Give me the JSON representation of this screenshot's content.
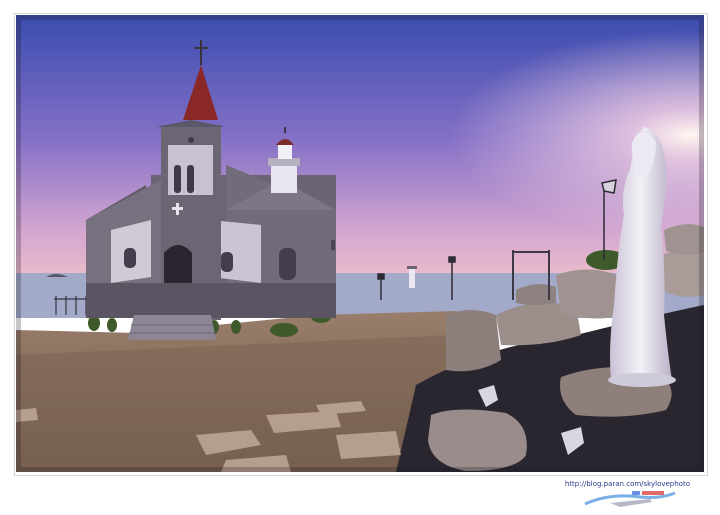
{
  "photo": {
    "subject": "stone church by the sea at dusk with lighthouse and Virgin Mary statue",
    "colors": {
      "sky_top": "#3c4fb0",
      "sky_mid": "#8a6fc8",
      "sky_horizon": "#e8b6c9",
      "sun_glow": "#fff4ee",
      "sea": "#9aa7c9",
      "ground": "#8a7260",
      "church_stone": "#6b6472",
      "roof": "#8a2a2a",
      "statue": "#e6e2ea"
    }
  },
  "watermark": {
    "url": "http://blog.paran.com/skylovephoto"
  }
}
